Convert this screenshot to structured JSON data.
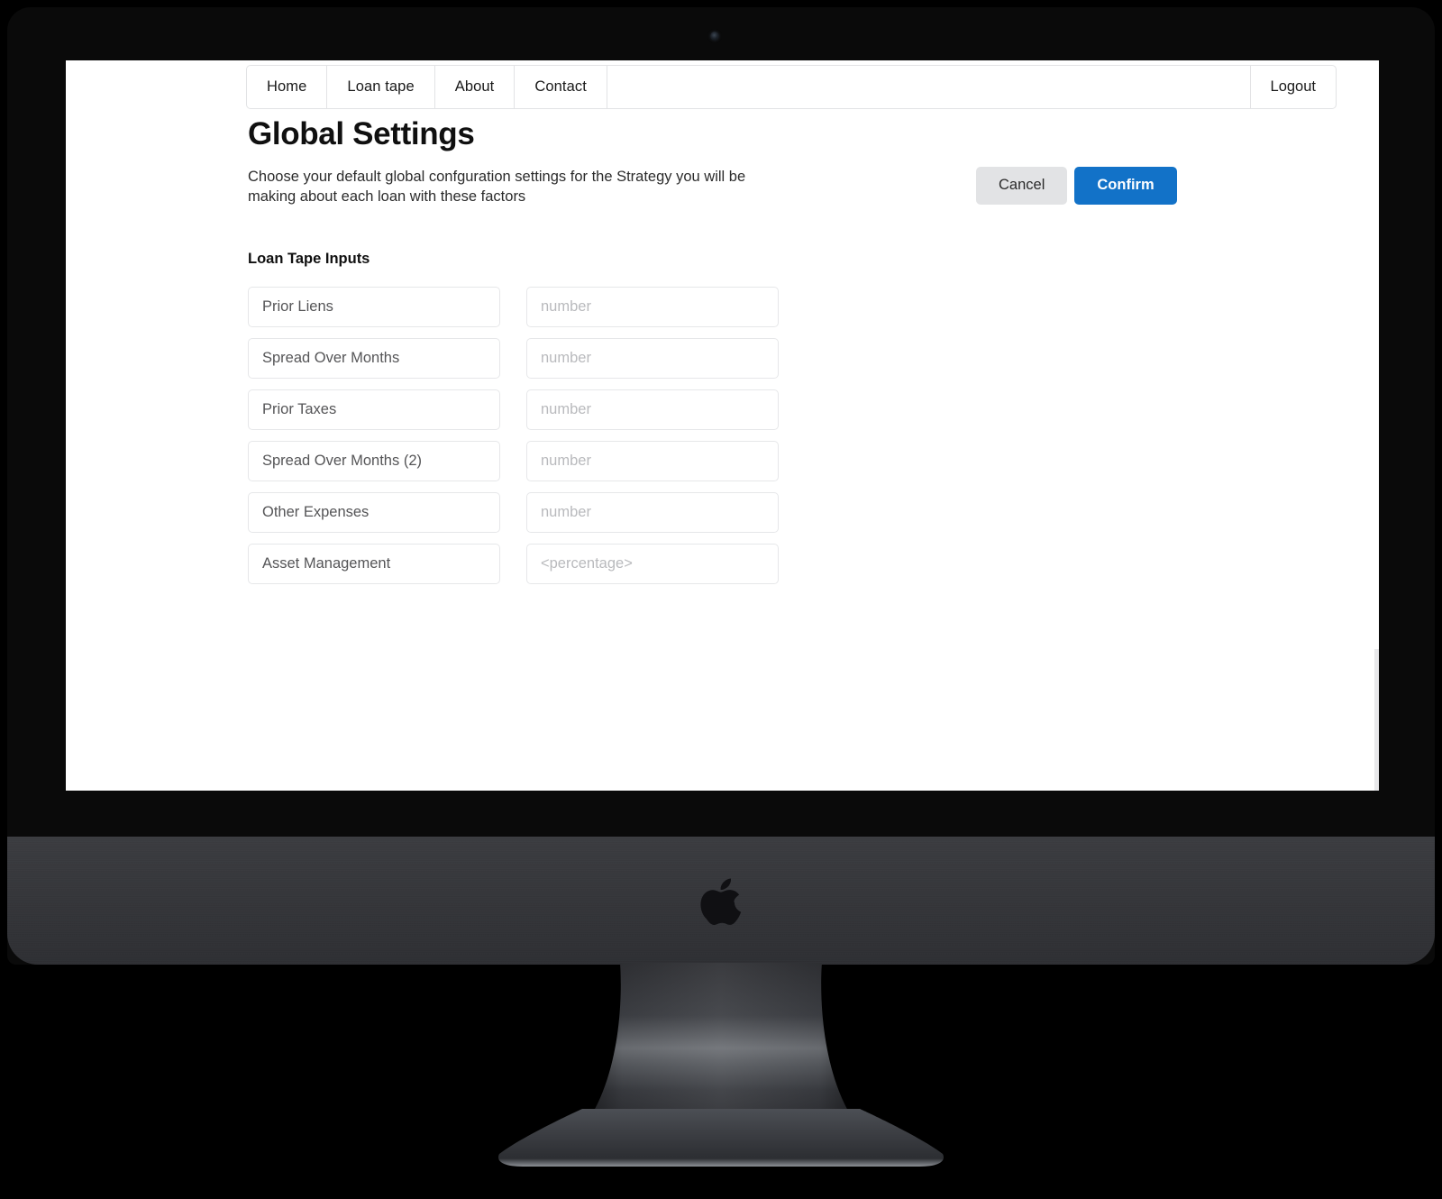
{
  "device": {
    "kind": "imac-desktop-monitor",
    "brand_logo_icon": "apple-logo-icon",
    "camera_icon": "camera-icon"
  },
  "navbar": {
    "items": [
      {
        "label": "Home",
        "name": "nav-item-home"
      },
      {
        "label": "Loan tape",
        "name": "nav-item-loan-tape"
      },
      {
        "label": "About",
        "name": "nav-item-about"
      },
      {
        "label": "Contact",
        "name": "nav-item-contact"
      }
    ],
    "logout_label": "Logout"
  },
  "page": {
    "title": "Global Settings",
    "subtitle": "Choose your default global confguration settings for the Strategy you will be making about each loan with these factors",
    "section_title": "Loan Tape Inputs"
  },
  "actions": {
    "cancel_label": "Cancel",
    "confirm_label": "Confirm"
  },
  "form": {
    "rows": [
      {
        "label": "Prior Liens",
        "value": "",
        "value_placeholder": "number"
      },
      {
        "label": "Spread Over Months",
        "value": "",
        "value_placeholder": "number"
      },
      {
        "label": "Prior Taxes",
        "value": "",
        "value_placeholder": "number"
      },
      {
        "label": "Spread Over Months (2)",
        "value": "",
        "value_placeholder": "number"
      },
      {
        "label": "Other Expenses",
        "value": "",
        "value_placeholder": "number"
      },
      {
        "label": "Asset Management",
        "value": "",
        "value_placeholder": "<percentage>"
      }
    ]
  },
  "colors": {
    "accent_blue": "#1272c8",
    "cancel_gray": "#e2e3e5",
    "field_border": "#e6e7e9",
    "placeholder_gray": "#b9babd",
    "label_gray": "#555557",
    "bezel_black": "#0a0a0a",
    "chin_gray": "#3b3c40",
    "page_white": "#ffffff"
  }
}
